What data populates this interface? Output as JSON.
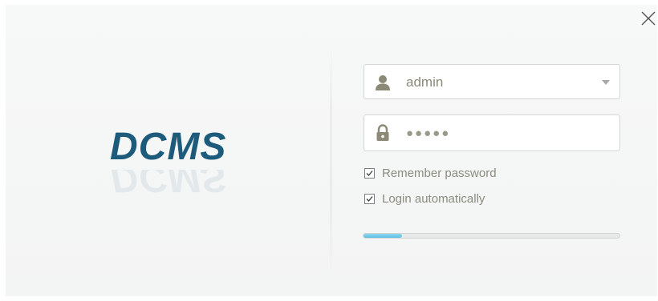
{
  "app": {
    "logo_text": "DCMS"
  },
  "login": {
    "username_value": "admin",
    "password_mask": "●●●●●",
    "remember_password_label": "Remember password",
    "remember_password_checked": true,
    "login_automatically_label": "Login automatically",
    "login_automatically_checked": true
  },
  "progress": {
    "fraction": 0.15,
    "color": "#5bbfe3"
  },
  "icons": {
    "user": "user-icon",
    "lock": "lock-icon",
    "close": "close-icon",
    "dropdown": "chevron-down-icon"
  },
  "colors": {
    "brand": "#1d5b7c",
    "text_muted": "#8b8b7e"
  }
}
